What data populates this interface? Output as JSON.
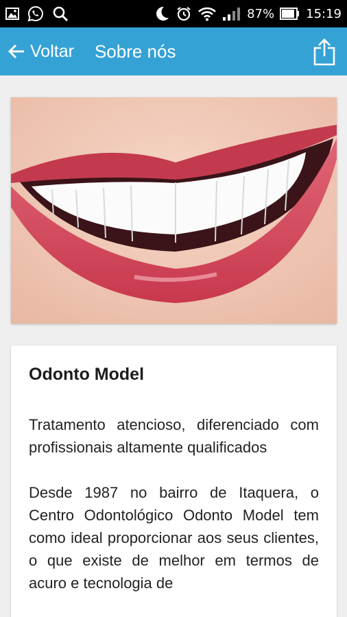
{
  "status_bar": {
    "battery": "87%",
    "time": "15:19",
    "left_icons": [
      "gallery-icon",
      "whatsapp-icon",
      "search-icon"
    ],
    "right_icons": [
      "moon-icon",
      "alarm-icon",
      "wifi-icon",
      "signal-icon",
      "battery-icon"
    ]
  },
  "app_bar": {
    "back_label": "Voltar",
    "title": "Sobre nós",
    "color": "#35a2d6"
  },
  "content": {
    "hero_image": "smile-photo",
    "title": "Odonto Model",
    "paragraph1": "Tratamento atencioso, diferenciado com profissionais altamente qualificados",
    "paragraph2": "Desde 1987 no bairro de Itaquera, o Centro Odontológico Odonto Model tem como ideal proporcionar aos seus clientes, o que existe de melhor em termos de acuro e tecnologia de"
  }
}
